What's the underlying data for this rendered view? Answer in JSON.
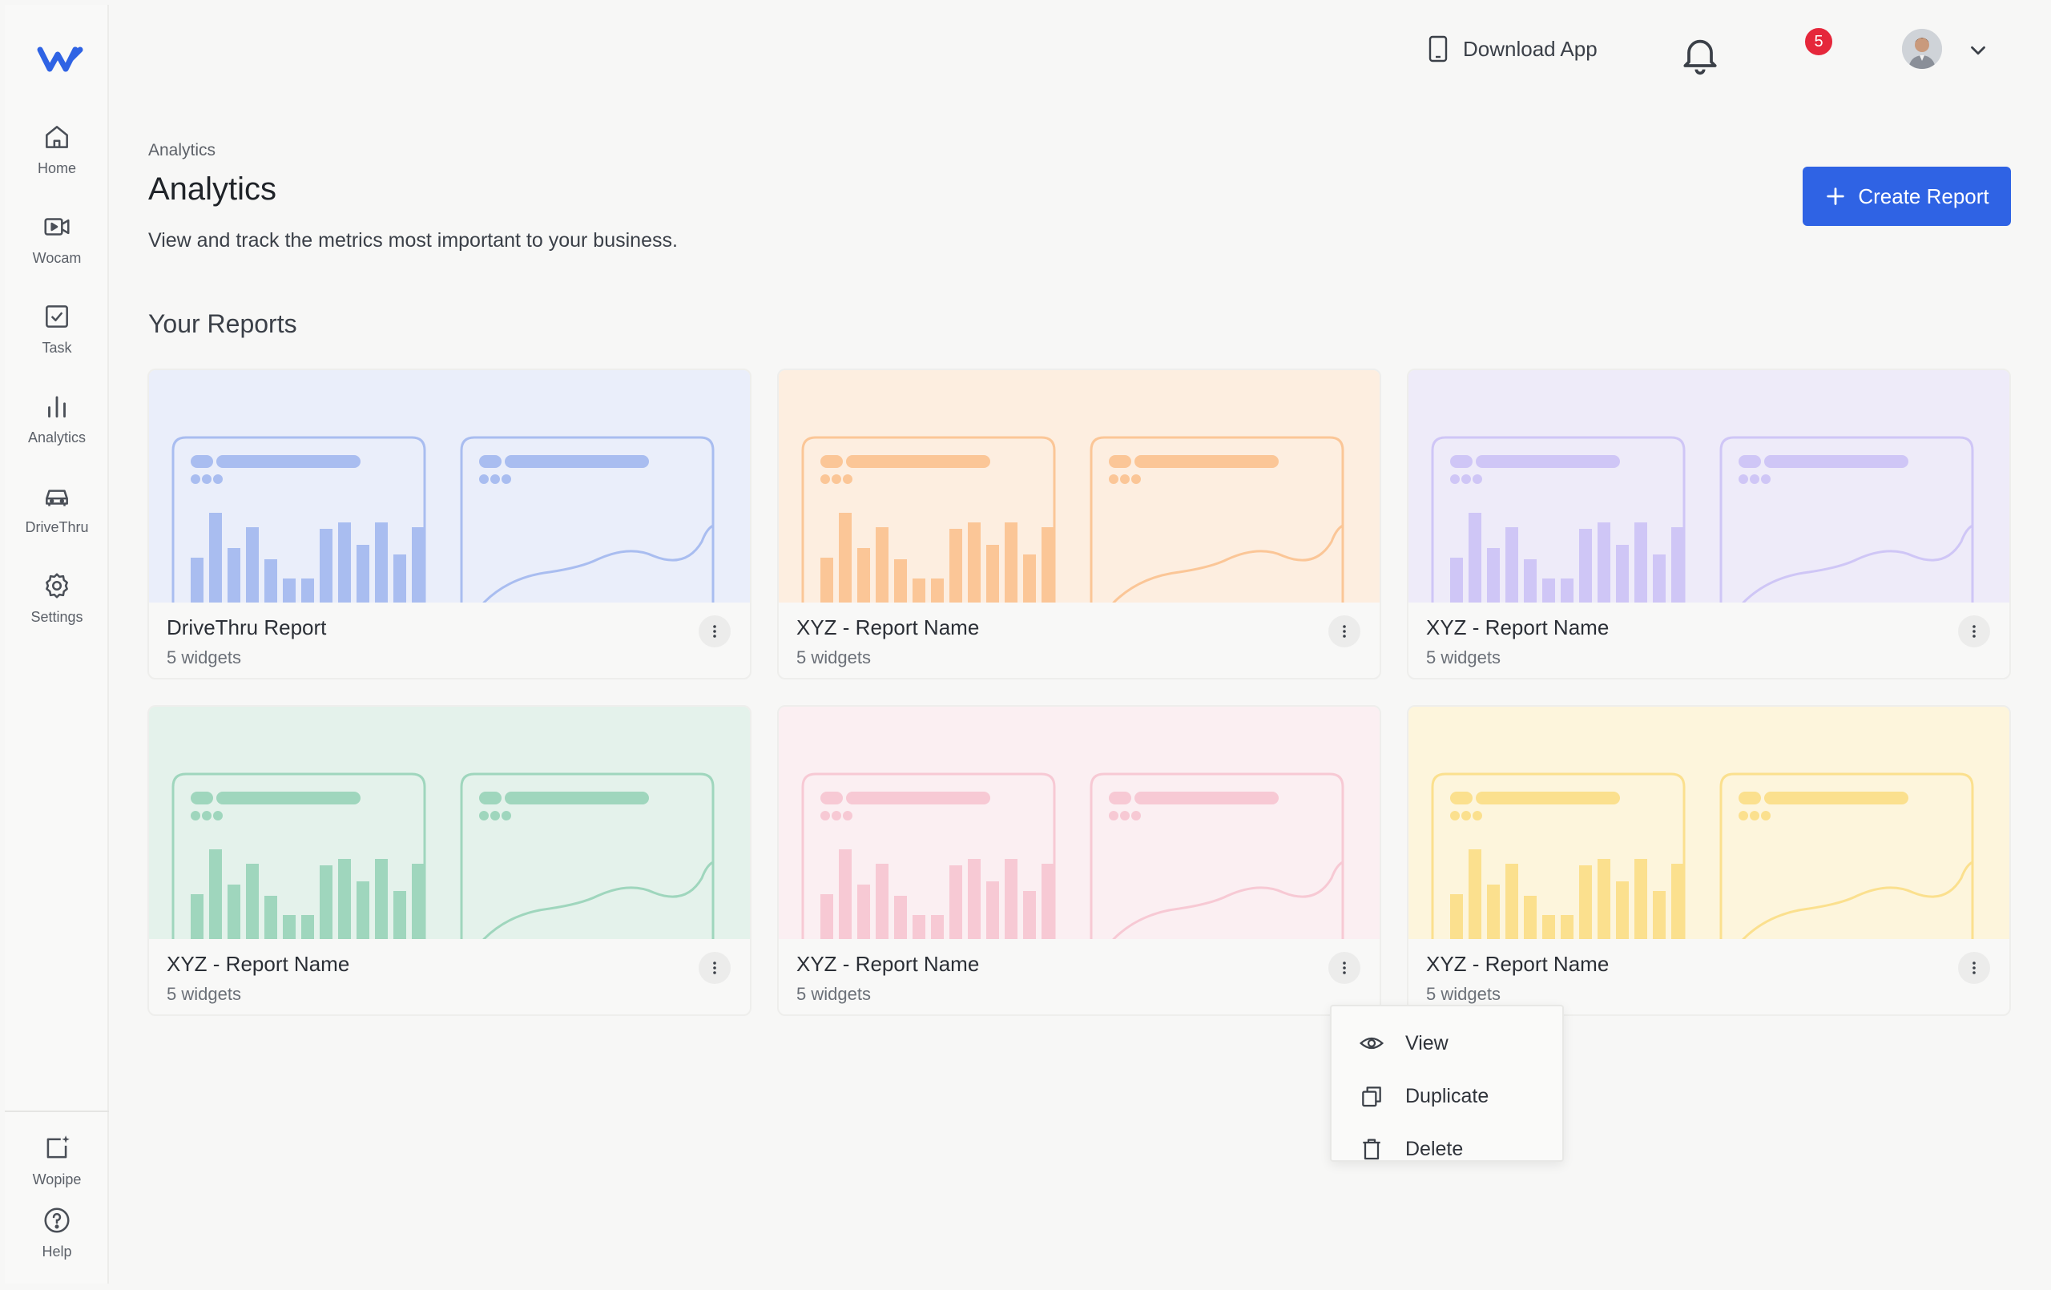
{
  "sidebar": {
    "items": [
      {
        "label": "Home",
        "icon": "home-icon"
      },
      {
        "label": "Wocam",
        "icon": "video-icon"
      },
      {
        "label": "Task",
        "icon": "checkbox-icon"
      },
      {
        "label": "Analytics",
        "icon": "bar-chart-icon"
      },
      {
        "label": "DriveThru",
        "icon": "car-icon"
      },
      {
        "label": "Settings",
        "icon": "gear-icon"
      }
    ],
    "bottom_items": [
      {
        "label": "Wopipe",
        "icon": "sparkle-note-icon"
      },
      {
        "label": "Help",
        "icon": "help-icon"
      }
    ]
  },
  "header": {
    "download_label": "Download App",
    "notification_count": "5"
  },
  "page": {
    "breadcrumb": "Analytics",
    "title": "Analytics",
    "subtitle": "View and track the metrics most important to your business.",
    "create_label": "Create Report",
    "section_title": "Your Reports"
  },
  "reports": [
    {
      "name": "DriveThru Report",
      "widgets": "5 widgets",
      "color": "#a9bdf0",
      "bg": "#eaeefa"
    },
    {
      "name": "XYZ - Report Name",
      "widgets": "5 widgets",
      "color": "#fbc697",
      "bg": "#fdeee0"
    },
    {
      "name": "XYZ - Report Name",
      "widgets": "5 widgets",
      "color": "#cfc6f6",
      "bg": "#eeebf9"
    },
    {
      "name": "XYZ - Report Name",
      "widgets": "5 widgets",
      "color": "#9fd6bd",
      "bg": "#e4f2eb"
    },
    {
      "name": "XYZ - Report Name",
      "widgets": "5 widgets",
      "color": "#f7c9d4",
      "bg": "#fbeff2"
    },
    {
      "name": "XYZ - Report Name",
      "widgets": "5 widgets",
      "color": "#fbe08e",
      "bg": "#fdf5dc"
    }
  ],
  "context_menu": {
    "items": [
      {
        "label": "View",
        "icon": "eye-icon"
      },
      {
        "label": "Duplicate",
        "icon": "copy-icon"
      },
      {
        "label": "Delete",
        "icon": "trash-icon"
      }
    ]
  },
  "colors": {
    "accent": "#2f63e4",
    "badge": "#e5273b",
    "logo": "#2f63e4"
  }
}
